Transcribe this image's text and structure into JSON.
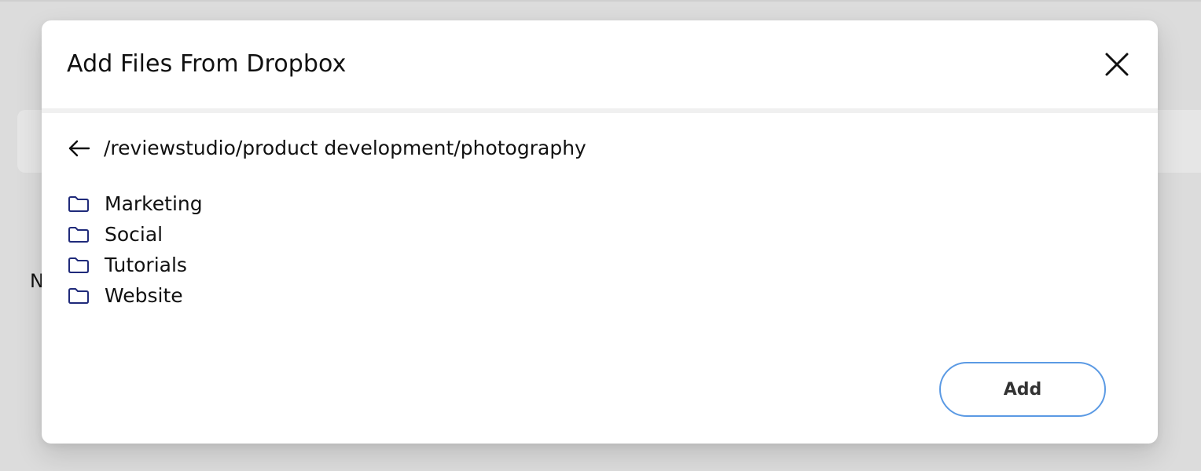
{
  "background": {
    "partial_letter": "N"
  },
  "dialog": {
    "title": "Add Files From Dropbox",
    "close_icon": "close-icon",
    "back_icon": "arrow-left-icon",
    "current_path": "/reviewstudio/product development/photography",
    "folders": [
      {
        "label": "Marketing",
        "icon": "folder-icon"
      },
      {
        "label": "Social",
        "icon": "folder-icon"
      },
      {
        "label": "Tutorials",
        "icon": "folder-icon"
      },
      {
        "label": "Website",
        "icon": "folder-icon"
      }
    ],
    "add_label": "Add"
  },
  "colors": {
    "folder_icon": "#1f2a7a",
    "add_border": "#5b9ae4",
    "overlay": "#dcdcdc"
  }
}
